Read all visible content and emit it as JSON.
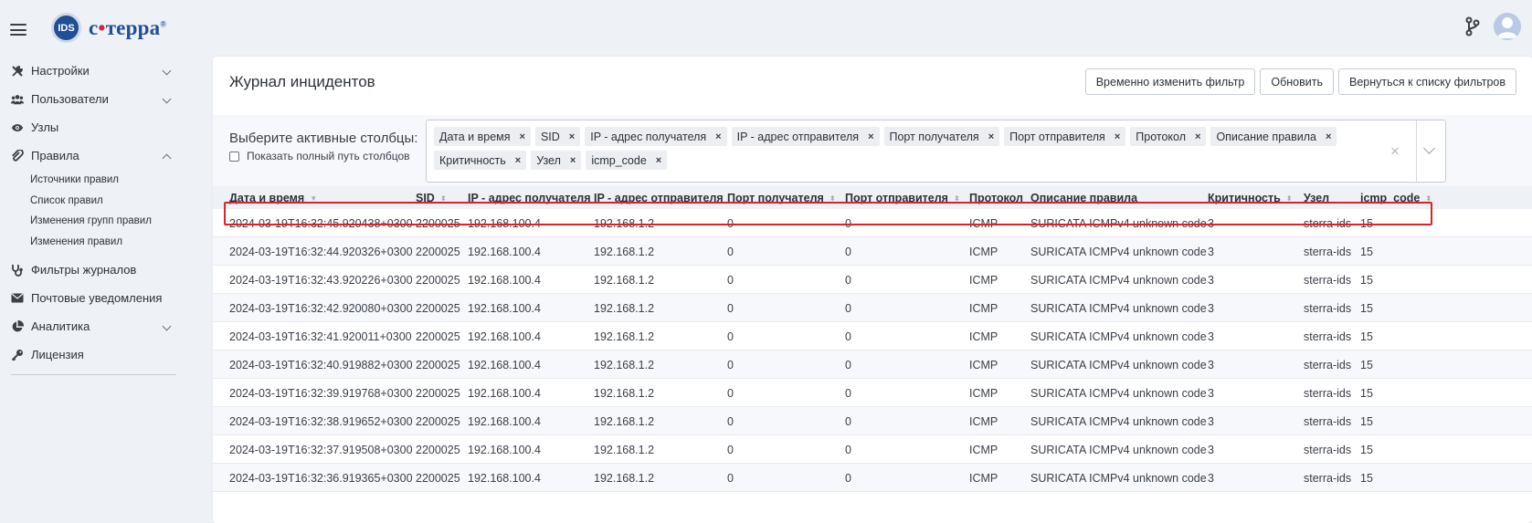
{
  "app": {
    "brand_badge": "IDS",
    "brand_pre": "с",
    "brand_dot": "•",
    "brand_post": "терра",
    "brand_reg": "®"
  },
  "sidebar": {
    "items": [
      {
        "label": "Настройки",
        "icon": "tools-icon"
      },
      {
        "label": "Пользователи",
        "icon": "users-icon"
      },
      {
        "label": "Узлы",
        "icon": "eye-icon"
      },
      {
        "label": "Правила",
        "icon": "paperclip-icon"
      }
    ],
    "sub_items": [
      "Источники правил",
      "Список правил",
      "Изменения групп правил",
      "Изменения правил"
    ],
    "items_after": [
      {
        "label": "Фильтры журналов",
        "icon": "stethoscope-icon"
      },
      {
        "label": "Почтовые уведомления",
        "icon": "envelope-icon"
      },
      {
        "label": "Аналитика",
        "icon": "pie-chart-icon"
      },
      {
        "label": "Лицензия",
        "icon": "key-icon"
      }
    ]
  },
  "main": {
    "title": "Журнал инцидентов",
    "buttons": [
      "Временно изменить фильтр",
      "Обновить",
      "Вернуться к списку фильтров"
    ],
    "filter_label": "Выберите активные столбцы:",
    "full_path_label": "Показать полный путь столбцов",
    "tags": [
      "Дата и время",
      "SID",
      "IP - адрес получателя",
      "IP - адрес отправителя",
      "Порт получателя",
      "Порт отправителя",
      "Протокол",
      "Описание правила",
      "Критичность",
      "Узел",
      "icmp_code"
    ],
    "tag_remove": "×",
    "clear_all": "×"
  },
  "table": {
    "columns": [
      "Дата и время",
      "SID",
      "IP - адрес получателя",
      "IP - адрес отправителя",
      "Порт получателя",
      "Порт отправителя",
      "Протокол",
      "Описание правила",
      "Критичность",
      "Узел",
      "icmp_code"
    ],
    "sort_glyph_desc": "▼",
    "sort_glyph_both": "⬍",
    "rows": [
      [
        "2024-03-19T16:32:45.920438+0300",
        "2200025",
        "192.168.100.4",
        "192.168.1.2",
        "0",
        "0",
        "ICMP",
        "SURICATA ICMPv4 unknown code",
        "3",
        "sterra-ids",
        "15"
      ],
      [
        "2024-03-19T16:32:44.920326+0300",
        "2200025",
        "192.168.100.4",
        "192.168.1.2",
        "0",
        "0",
        "ICMP",
        "SURICATA ICMPv4 unknown code",
        "3",
        "sterra-ids",
        "15"
      ],
      [
        "2024-03-19T16:32:43.920226+0300",
        "2200025",
        "192.168.100.4",
        "192.168.1.2",
        "0",
        "0",
        "ICMP",
        "SURICATA ICMPv4 unknown code",
        "3",
        "sterra-ids",
        "15"
      ],
      [
        "2024-03-19T16:32:42.920080+0300",
        "2200025",
        "192.168.100.4",
        "192.168.1.2",
        "0",
        "0",
        "ICMP",
        "SURICATA ICMPv4 unknown code",
        "3",
        "sterra-ids",
        "15"
      ],
      [
        "2024-03-19T16:32:41.920011+0300",
        "2200025",
        "192.168.100.4",
        "192.168.1.2",
        "0",
        "0",
        "ICMP",
        "SURICATA ICMPv4 unknown code",
        "3",
        "sterra-ids",
        "15"
      ],
      [
        "2024-03-19T16:32:40.919882+0300",
        "2200025",
        "192.168.100.4",
        "192.168.1.2",
        "0",
        "0",
        "ICMP",
        "SURICATA ICMPv4 unknown code",
        "3",
        "sterra-ids",
        "15"
      ],
      [
        "2024-03-19T16:32:39.919768+0300",
        "2200025",
        "192.168.100.4",
        "192.168.1.2",
        "0",
        "0",
        "ICMP",
        "SURICATA ICMPv4 unknown code",
        "3",
        "sterra-ids",
        "15"
      ],
      [
        "2024-03-19T16:32:38.919652+0300",
        "2200025",
        "192.168.100.4",
        "192.168.1.2",
        "0",
        "0",
        "ICMP",
        "SURICATA ICMPv4 unknown code",
        "3",
        "sterra-ids",
        "15"
      ],
      [
        "2024-03-19T16:32:37.919508+0300",
        "2200025",
        "192.168.100.4",
        "192.168.1.2",
        "0",
        "0",
        "ICMP",
        "SURICATA ICMPv4 unknown code",
        "3",
        "sterra-ids",
        "15"
      ],
      [
        "2024-03-19T16:32:36.919365+0300",
        "2200025",
        "192.168.100.4",
        "192.168.1.2",
        "0",
        "0",
        "ICMP",
        "SURICATA ICMPv4 unknown code",
        "3",
        "sterra-ids",
        "15"
      ]
    ],
    "selected_row": 0
  },
  "colors": {
    "brand": "#1f4f95",
    "accent_red": "#d0263a",
    "selection_border": "#d9252a",
    "page_bg": "#eef1f6"
  }
}
